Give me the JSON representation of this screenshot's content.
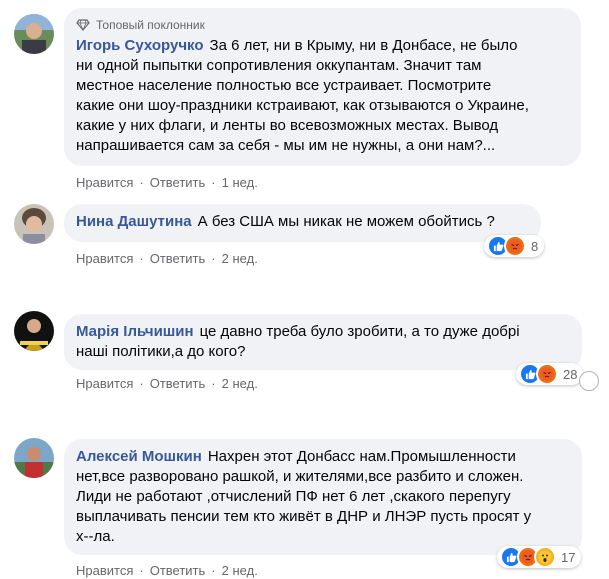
{
  "comments": [
    {
      "badge": "Топовый поклонник",
      "author": "Игорь Сухоручко",
      "lines": [
        "За 6 лет, ни в Крыму, ни в Донбасе, не было",
        "ни одной пыпытки сопротивления оккупантам. Значит там",
        "местное население полностью все устраивает. Посмотрите",
        "какие они шоу-праздники кстраивают, как отзываются о Украине,",
        "какие у них флаги, и ленты во всевозможных местах. Вывод",
        "напрашивается сам за себя - мы им не нужны, а они нам?..."
      ],
      "like": "Нравится",
      "reply": "Ответить",
      "time": "1 нед."
    },
    {
      "author": "Нина Дашутина",
      "lines": [
        "А без США мы никак не можем обойтись ?"
      ],
      "like": "Нравится",
      "reply": "Ответить",
      "time": "2 нед.",
      "reactions": {
        "icons": [
          "like",
          "angry"
        ],
        "count": "8"
      }
    },
    {
      "author": "Марія Ільчишин",
      "lines": [
        "це давно треба було зробити, а то дуже добрі",
        "наші політики,а до кого?"
      ],
      "like": "Нравится",
      "reply": "Ответить",
      "time": "2 нед.",
      "reactions": {
        "icons": [
          "like",
          "angry"
        ],
        "count": "28"
      }
    },
    {
      "author": "Алексей Мошкин",
      "lines": [
        "Нахрен этот Донбасс нам.Промышленности",
        "нет,все разворовано рашкой, и жителями,все разбито и сложен.",
        "Лиди не работают ,отчислений ПФ нет 6 лет ,скакого перепугу",
        "выплачивать пенсии тем кто живёт в ДНР и ЛНЭР пусть просят у",
        "х--ла."
      ],
      "like": "Нравится",
      "reply": "Ответить",
      "time": "2 нед.",
      "reactions": {
        "icons": [
          "like",
          "angry",
          "wow"
        ],
        "count": "17"
      }
    }
  ],
  "colors": {
    "author": "#385898",
    "bubble": "#f0f2f5",
    "meta": "#65676b",
    "like": "#1877f2",
    "angry": "#e9710f"
  }
}
